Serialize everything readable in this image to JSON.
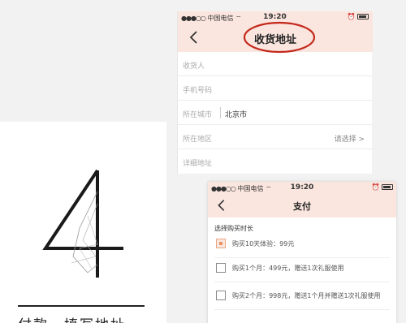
{
  "colors": {
    "header_bg": "#fbe6df",
    "annotation_red": "#c4281c",
    "checkbox_accent": "#e89262"
  },
  "left_card": {
    "big_number": "4",
    "caption": "付款、填写地址"
  },
  "phone1": {
    "status": {
      "carrier": "中国电信",
      "time": "19:20"
    },
    "nav": {
      "back_icon": "chevron-left-icon",
      "title": "收货地址"
    },
    "form": [
      {
        "label": "收货人",
        "value": "",
        "hint": ""
      },
      {
        "label": "手机号码",
        "value": "",
        "hint": ""
      },
      {
        "label": "所在城市",
        "value": "北京市",
        "hint": ""
      },
      {
        "label": "所在地区",
        "value": "",
        "hint": "请选择 >"
      },
      {
        "label": "详细地址",
        "value": "",
        "hint": ""
      }
    ]
  },
  "phone2": {
    "status": {
      "carrier": "中国电信",
      "time": "19:20"
    },
    "nav": {
      "back_icon": "chevron-left-icon",
      "title": "支付"
    },
    "section_title": "选择购买时长",
    "options": [
      {
        "label": "购买10天体验：99元",
        "checked": true
      },
      {
        "label": "购买1个月：499元，赠送1次礼服使用",
        "checked": false
      },
      {
        "label": "购买2个月：998元，赠送1个月并赠送1次礼服使用",
        "checked": false
      }
    ]
  }
}
